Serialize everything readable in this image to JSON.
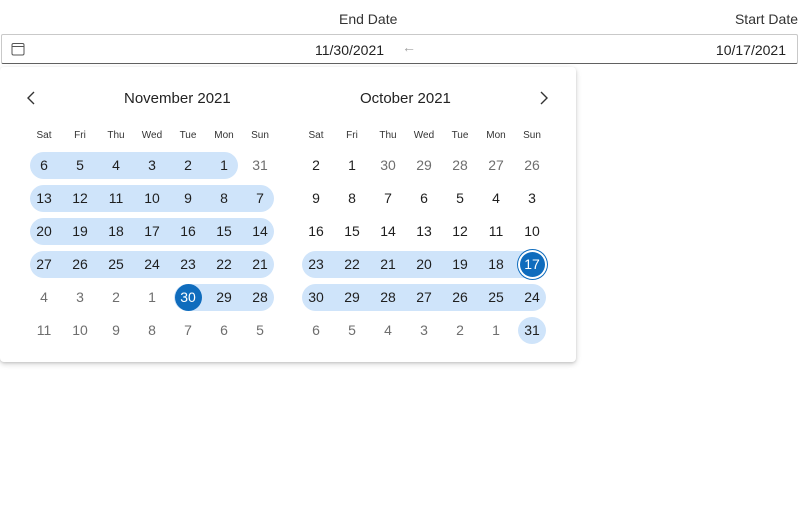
{
  "header": {
    "end_label": "End Date",
    "start_label": "Start Date"
  },
  "input": {
    "end_value": "11/30/2021",
    "start_value": "10/17/2021",
    "arrow": "←"
  },
  "icons": {
    "calendar": "calendar-icon",
    "prev": "chevron-left-icon",
    "next": "chevron-right-icon"
  },
  "colors": {
    "accent": "#0f6cbd",
    "range_fill": "#cfe4fa"
  },
  "weekdays": [
    "Sat",
    "Fri",
    "Thu",
    "Wed",
    "Tue",
    "Mon",
    "Sun"
  ],
  "months": [
    {
      "title": "November 2021",
      "weeks": [
        [
          {
            "d": "6"
          },
          {
            "d": "5"
          },
          {
            "d": "4"
          },
          {
            "d": "3"
          },
          {
            "d": "2"
          },
          {
            "d": "1"
          },
          {
            "d": "31",
            "o": true
          }
        ],
        [
          {
            "d": "13"
          },
          {
            "d": "12"
          },
          {
            "d": "11"
          },
          {
            "d": "10"
          },
          {
            "d": "9"
          },
          {
            "d": "8"
          },
          {
            "d": "7"
          }
        ],
        [
          {
            "d": "20"
          },
          {
            "d": "19"
          },
          {
            "d": "18"
          },
          {
            "d": "17"
          },
          {
            "d": "16"
          },
          {
            "d": "15"
          },
          {
            "d": "14"
          }
        ],
        [
          {
            "d": "27"
          },
          {
            "d": "26"
          },
          {
            "d": "25"
          },
          {
            "d": "24"
          },
          {
            "d": "23"
          },
          {
            "d": "22"
          },
          {
            "d": "21"
          }
        ],
        [
          {
            "d": "4",
            "o": true
          },
          {
            "d": "3",
            "o": true
          },
          {
            "d": "2",
            "o": true
          },
          {
            "d": "1",
            "o": true
          },
          {
            "d": "30",
            "sel": true
          },
          {
            "d": "29"
          },
          {
            "d": "28"
          }
        ],
        [
          {
            "d": "11",
            "o": true
          },
          {
            "d": "10",
            "o": true
          },
          {
            "d": "9",
            "o": true
          },
          {
            "d": "8",
            "o": true
          },
          {
            "d": "7",
            "o": true
          },
          {
            "d": "6",
            "o": true
          },
          {
            "d": "5",
            "o": true
          }
        ]
      ],
      "bands": [
        [
          0,
          5
        ],
        [
          0,
          6
        ],
        [
          0,
          6
        ],
        [
          0,
          6
        ],
        [
          4,
          6
        ],
        null
      ]
    },
    {
      "title": "October 2021",
      "weeks": [
        [
          {
            "d": "2"
          },
          {
            "d": "1"
          },
          {
            "d": "30",
            "o": true
          },
          {
            "d": "29",
            "o": true
          },
          {
            "d": "28",
            "o": true
          },
          {
            "d": "27",
            "o": true
          },
          {
            "d": "26",
            "o": true
          }
        ],
        [
          {
            "d": "9"
          },
          {
            "d": "8"
          },
          {
            "d": "7"
          },
          {
            "d": "6"
          },
          {
            "d": "5"
          },
          {
            "d": "4"
          },
          {
            "d": "3"
          }
        ],
        [
          {
            "d": "16"
          },
          {
            "d": "15"
          },
          {
            "d": "14"
          },
          {
            "d": "13"
          },
          {
            "d": "12"
          },
          {
            "d": "11"
          },
          {
            "d": "10"
          }
        ],
        [
          {
            "d": "23"
          },
          {
            "d": "22"
          },
          {
            "d": "21"
          },
          {
            "d": "20"
          },
          {
            "d": "19"
          },
          {
            "d": "18"
          },
          {
            "d": "17",
            "sel": true,
            "ring": true
          }
        ],
        [
          {
            "d": "30"
          },
          {
            "d": "29"
          },
          {
            "d": "28"
          },
          {
            "d": "27"
          },
          {
            "d": "26"
          },
          {
            "d": "25"
          },
          {
            "d": "24"
          }
        ],
        [
          {
            "d": "6",
            "o": true
          },
          {
            "d": "5",
            "o": true
          },
          {
            "d": "4",
            "o": true
          },
          {
            "d": "3",
            "o": true
          },
          {
            "d": "2",
            "o": true
          },
          {
            "d": "1",
            "o": true
          },
          {
            "d": "31",
            "single": true
          }
        ]
      ],
      "bands": [
        null,
        null,
        null,
        [
          0,
          6
        ],
        [
          0,
          6
        ],
        null
      ]
    }
  ]
}
